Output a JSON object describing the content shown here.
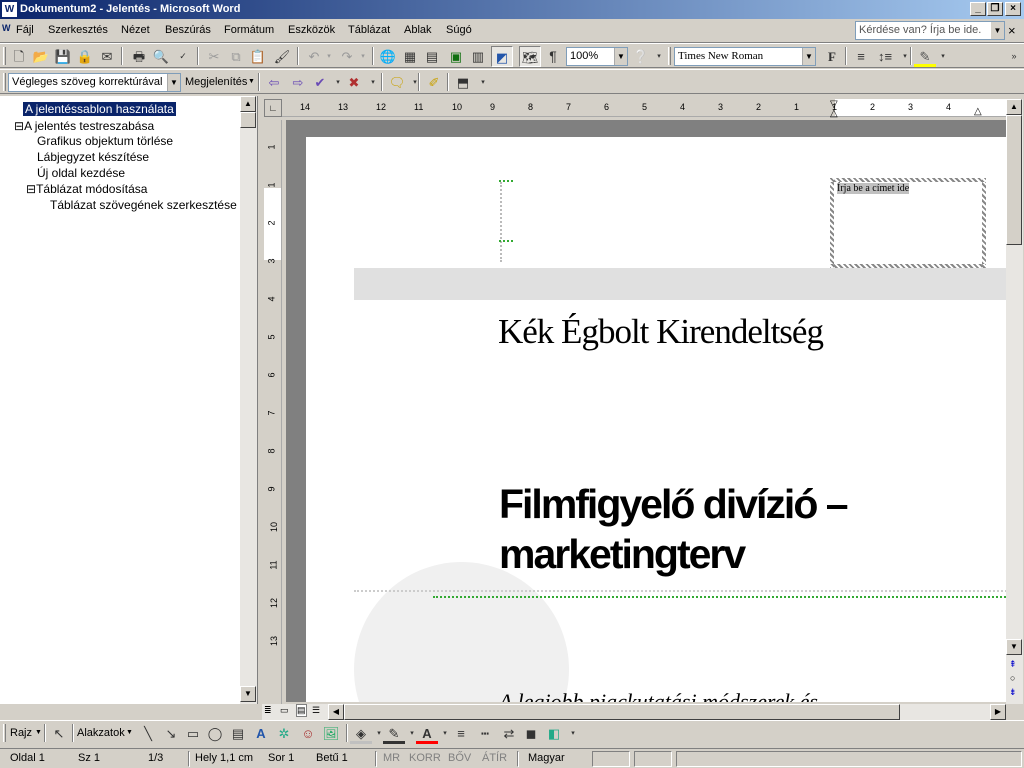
{
  "window": {
    "title": "Dokumentum2 - Jelentés - Microsoft Word",
    "app_icon": "W"
  },
  "menu": [
    "Fájl",
    "Szerkesztés",
    "Nézet",
    "Beszúrás",
    "Formátum",
    "Eszközök",
    "Táblázat",
    "Ablak",
    "Súgó"
  ],
  "ask_box": {
    "placeholder": "Kérdése van? Írja be ide."
  },
  "standard_toolbar": {
    "zoom": "100%",
    "font": "Times New Roman",
    "icons": [
      "new-document-icon",
      "open-icon",
      "save-icon",
      "permission-icon",
      "email-icon",
      "print-icon",
      "print-preview-icon",
      "spelling-icon",
      "cut-icon",
      "copy-icon",
      "paste-icon",
      "format-painter-icon",
      "undo-icon",
      "redo-icon",
      "hyperlink-icon",
      "tables-borders-icon",
      "insert-table-icon",
      "insert-excel-icon",
      "columns-icon",
      "drawing-icon",
      "document-map-icon",
      "show-formatting-icon"
    ]
  },
  "review_toolbar": {
    "display_mode": "Végleges szöveg korrektúrával",
    "show_label": "Megjelenítés"
  },
  "document_map": {
    "nodes": [
      {
        "label": "A jelentéssablon használata",
        "expander": "",
        "selected": true
      },
      {
        "label": "A jelentés testreszabása",
        "expander": "⊟",
        "selected": false
      },
      {
        "label": "Grafikus objektum törlése",
        "expander": "",
        "selected": false
      },
      {
        "label": "Lábjegyzet készítése",
        "expander": "",
        "selected": false
      },
      {
        "label": "Új oldal kezdése",
        "expander": "",
        "selected": false
      },
      {
        "label": "Táblázat módosítása",
        "expander": "⊟",
        "selected": false
      },
      {
        "label": "Táblázat szövegének szerkesztése",
        "expander": "",
        "selected": false
      }
    ]
  },
  "ruler": {
    "h_labels": [
      "14",
      "13",
      "12",
      "11",
      "10",
      "9",
      "8",
      "7",
      "6",
      "5",
      "4",
      "3",
      "2",
      "1",
      "1",
      "2",
      "3",
      "4"
    ],
    "v_labels": [
      "1",
      "1",
      "2",
      "3",
      "4",
      "5",
      "6",
      "7",
      "8",
      "9",
      "10",
      "11",
      "12",
      "13"
    ]
  },
  "document": {
    "title_placeholder": "Írja be a címet ide",
    "company": "Kék Égbolt Kirendeltség",
    "heading_line1": "Filmfigyelő divízió –",
    "heading_line2": "marketingterv",
    "subtitle_partial": "A legjobb piackutatási módszerek és"
  },
  "drawing_toolbar": {
    "draw_label": "Rajz",
    "autoshapes_label": "Alakzatok"
  },
  "status_bar": {
    "page": "Oldal 1",
    "section": "Sz 1",
    "page_of": "1/3",
    "position": "Hely 1,1 cm",
    "line": "Sor 1",
    "column": "Betű 1",
    "mr": "MR",
    "korr": "KORR",
    "bov": "BŐV",
    "atir": "ÁTÍR",
    "language": "Magyar"
  },
  "colors": {
    "titlebar_start": "#0a246a",
    "titlebar_end": "#a6caf0",
    "selection": "#0a246a"
  }
}
